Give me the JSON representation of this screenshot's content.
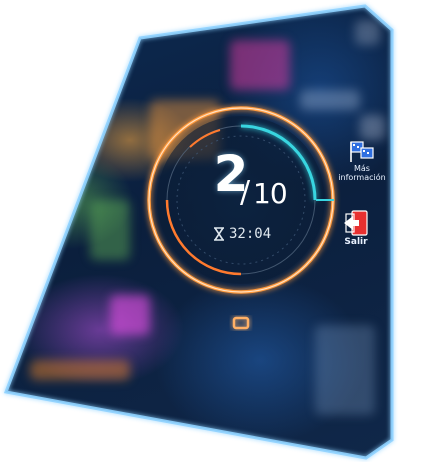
{
  "counter": {
    "current": "2",
    "separator": "/",
    "total": "10"
  },
  "timer": {
    "icon": "hourglass-icon",
    "value": "32:04"
  },
  "side_menu": {
    "more_info_label": "Más\ninformación",
    "more_info_icon": "flags-icon",
    "exit_label": "Salir",
    "exit_icon": "exit-door-icon"
  },
  "colors": {
    "ring_orange": "#ff9a3c",
    "ring_glow": "#ffd0a0",
    "arc_cyan": "#39d5e0",
    "arc_orange": "#ff7a2e",
    "panel_border": "#8fd2ff",
    "exit_red": "#e83030"
  }
}
